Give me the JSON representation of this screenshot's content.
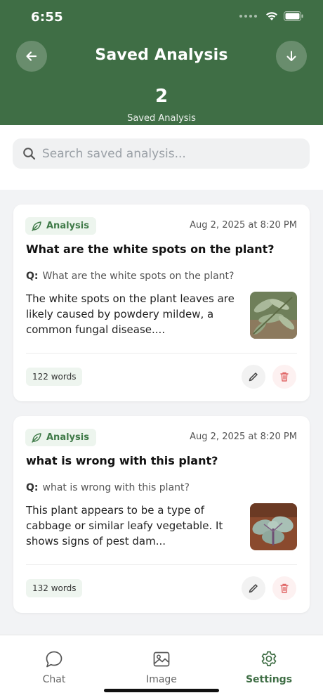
{
  "status_bar": {
    "time": "6:55"
  },
  "header": {
    "title": "Saved Analysis",
    "count": "2",
    "count_label": "Saved Analysis",
    "back_icon": "arrow-left-icon",
    "download_icon": "arrow-down-icon",
    "bg_color": "#3f6e45"
  },
  "search": {
    "placeholder": "Search saved analysis...",
    "value": ""
  },
  "cards": [
    {
      "tag": "Analysis",
      "date": "Aug 2, 2025 at 8:20 PM",
      "title": "What are the white spots on the plant?",
      "q_label": "Q:",
      "question": "What are the white spots on the plant?",
      "body": "The white spots on the plant leaves are likely caused by powdery mildew, a common fungal disease....",
      "words": "122 words"
    },
    {
      "tag": "Analysis",
      "date": "Aug 2, 2025 at 8:20 PM",
      "title": "what is wrong with this plant?",
      "q_label": "Q:",
      "question": "what is wrong with this plant?",
      "body": "This plant appears to be a type of cabbage or similar leafy vegetable. It shows signs of pest dam...",
      "words": "132 words"
    }
  ],
  "bottom_nav": {
    "items": [
      {
        "label": "Chat",
        "icon": "chat-bubble-icon"
      },
      {
        "label": "Image",
        "icon": "image-icon"
      },
      {
        "label": "Settings",
        "icon": "gear-icon",
        "active": true
      }
    ]
  },
  "colors": {
    "accent": "#3f6e45",
    "delete": "#e06666"
  }
}
